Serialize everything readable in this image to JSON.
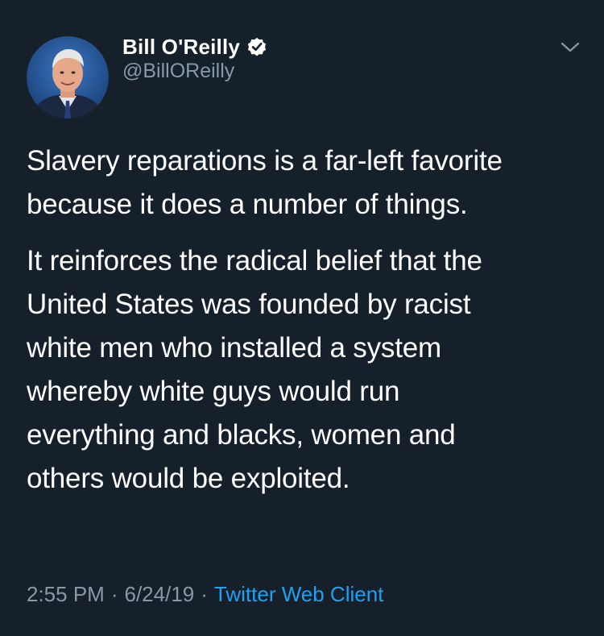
{
  "author": {
    "display_name": "Bill O'Reilly",
    "handle": "@BillOReilly",
    "verified": true,
    "avatar_icon": "profile-photo"
  },
  "tweet": {
    "paragraphs": [
      "Slavery reparations is a far-left favorite\nbecause it does a number of things.",
      "It reinforces the radical belief that the\nUnited States was founded by racist\nwhite men who installed a system\nwhereby white guys would run\neverything and blacks, women and\nothers would be exploited."
    ],
    "time": "2:55 PM",
    "date": "6/24/19",
    "separator": "·",
    "source": "Twitter Web Client"
  },
  "icons": {
    "verified": "verified-badge-icon",
    "menu": "chevron-down-icon"
  },
  "colors": {
    "background": "#15202b",
    "text": "#ffffff",
    "secondary": "#8899a6",
    "accent": "#1da1f2"
  }
}
